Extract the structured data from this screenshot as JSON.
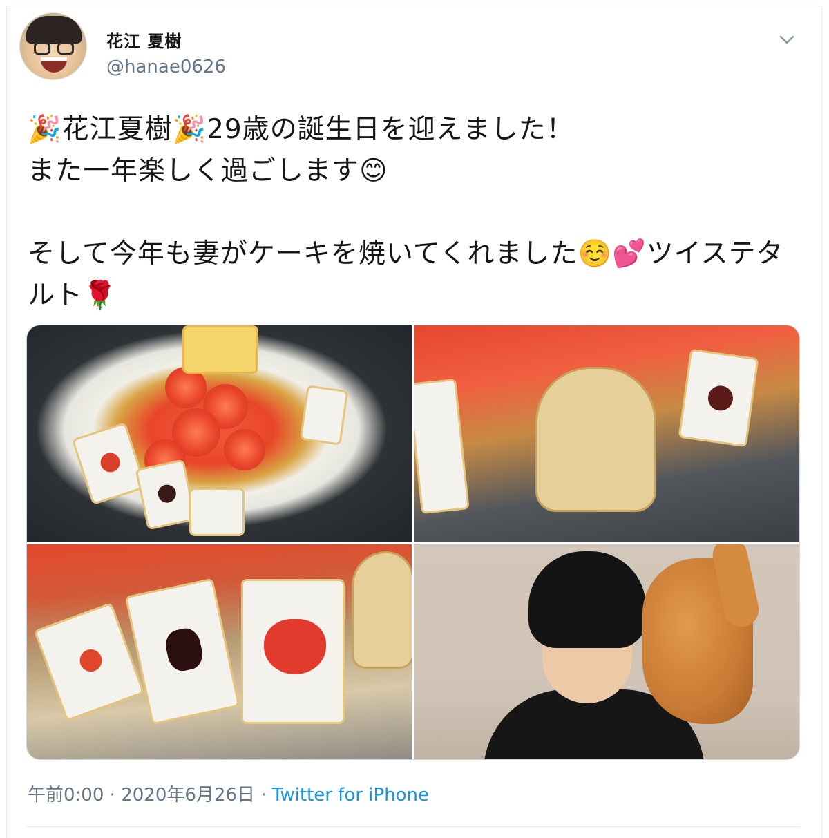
{
  "user": {
    "display_name": "花江 夏樹",
    "handle": "@hanae0626"
  },
  "tweet": {
    "text": "🎉花江夏樹🎉29歳の誕生日を迎えました！\nまた一年楽しく過ごします😊\n\nそして今年も妻がケーキを焼いてくれました☺️💕ツイステタルト🌹"
  },
  "meta": {
    "time": "午前0:00",
    "separator1": " · ",
    "date": "2020年6月26日",
    "separator2": " · ",
    "source": "Twitter for iPhone"
  },
  "icons": {
    "menu": "chevron-down-icon"
  },
  "colors": {
    "link": "#1b95e0",
    "secondary_text": "#657786",
    "border": "#e6ecf0"
  }
}
